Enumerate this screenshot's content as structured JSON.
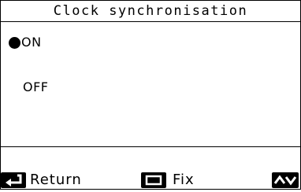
{
  "header": {
    "title": "Clock synchronisation"
  },
  "options": [
    {
      "label": "ON",
      "selected": true
    },
    {
      "label": "OFF",
      "selected": false
    }
  ],
  "footer": {
    "return_label": "Return",
    "fix_label": "Fix",
    "return_icon": "return-arrow-icon",
    "fix_icon": "square-button-icon",
    "updown_icon": "up-down-arrows-icon"
  }
}
